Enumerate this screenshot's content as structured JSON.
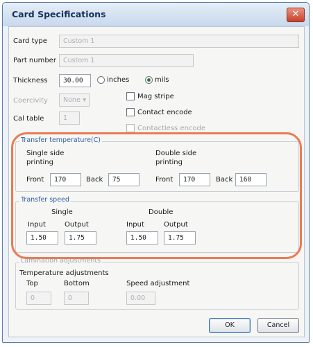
{
  "window": {
    "title": "Card Specifications",
    "close_glyph": "✕"
  },
  "card_type": {
    "label": "Card type",
    "value": "Custom 1"
  },
  "part_number": {
    "label": "Part number",
    "value": "Custom 1"
  },
  "thickness": {
    "label": "Thickness",
    "value": "30.00",
    "unit_inches": "inches",
    "unit_mils": "mils",
    "selected_unit": "mils"
  },
  "coercivity": {
    "label": "Coercivity",
    "value": "None"
  },
  "cal_table": {
    "label": "Cal table",
    "value": "1"
  },
  "options": {
    "mag_stripe": "Mag stripe",
    "contact_encode": "Contact encode",
    "contactless_encode": "Contactless encode"
  },
  "transfer_temperature": {
    "legend": "Transfer temperature(C)",
    "single_label_1": "Single side",
    "single_label_2": "printing",
    "double_label_1": "Double side",
    "double_label_2": "printing",
    "front_label": "Front",
    "back_label": "Back",
    "single_front": "170",
    "single_back": "75",
    "double_front": "170",
    "double_back": "160"
  },
  "transfer_speed": {
    "legend": "Transfer speed",
    "single_label": "Single",
    "double_label": "Double",
    "input_label": "Input",
    "output_label": "Output",
    "single_input": "1.50",
    "single_output": "1.75",
    "double_input": "1.50",
    "double_output": "1.75"
  },
  "lamination": {
    "legend": "Lamination adjustments",
    "temp_label": "Temperature adjustments",
    "top_label": "Top",
    "bottom_label": "Bottom",
    "speed_label": "Speed adjustment",
    "top_value": "0",
    "bottom_value": "0",
    "speed_value": "0.00"
  },
  "buttons": {
    "ok": "OK",
    "cancel": "Cancel"
  },
  "colors": {
    "annotation": "#ec7a52",
    "legend_text": "#2f5faa",
    "radio_selected": "#2f7d28"
  }
}
